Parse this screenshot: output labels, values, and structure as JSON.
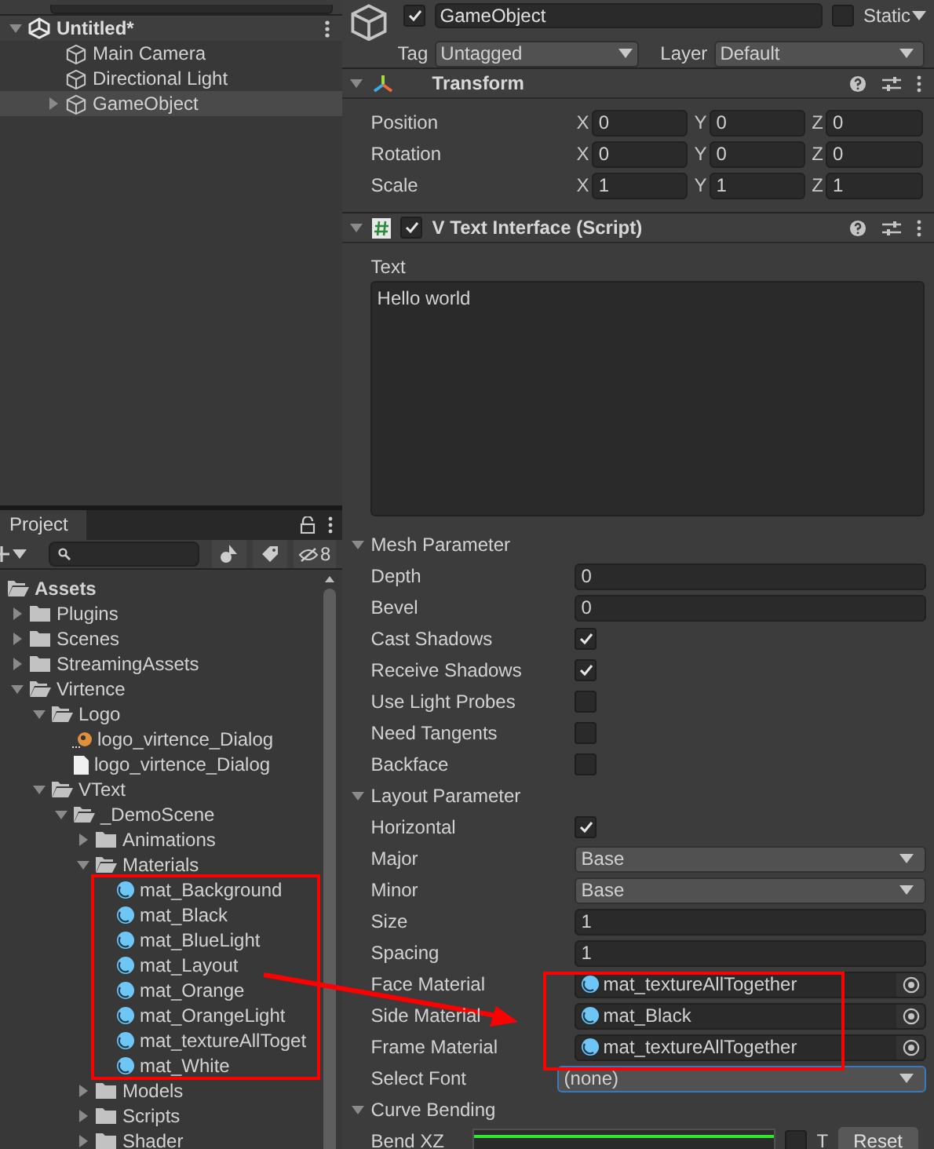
{
  "hierarchy": {
    "items": [
      {
        "label": "Untitled*",
        "kind": "scene",
        "expanded": true,
        "selected": false,
        "children": [
          {
            "label": "Main Camera",
            "kind": "object",
            "selected": false
          },
          {
            "label": "Directional Light",
            "kind": "object",
            "selected": false
          },
          {
            "label": "GameObject",
            "kind": "object",
            "expanded": false,
            "selected": true
          }
        ]
      }
    ]
  },
  "project": {
    "tab": "Project",
    "hidden_count": "8",
    "tree": [
      {
        "label": "Assets",
        "kind": "folder",
        "children": [
          {
            "label": "Plugins",
            "kind": "folder",
            "expanded": false
          },
          {
            "label": "Scenes",
            "kind": "folder",
            "expanded": false
          },
          {
            "label": "StreamingAssets",
            "kind": "folder",
            "expanded": false
          },
          {
            "label": "Virtence",
            "kind": "folder",
            "expanded": true,
            "children": [
              {
                "label": "Logo",
                "kind": "folder",
                "expanded": true,
                "children": [
                  {
                    "label": "logo_virtence_Dialog",
                    "kind": "image"
                  },
                  {
                    "label": "logo_virtence_Dialog",
                    "kind": "file"
                  }
                ]
              },
              {
                "label": "VText",
                "kind": "folder",
                "expanded": true,
                "children": [
                  {
                    "label": "_DemoScene",
                    "kind": "folder",
                    "expanded": true,
                    "children": [
                      {
                        "label": "Animations",
                        "kind": "folder",
                        "expanded": false
                      },
                      {
                        "label": "Materials",
                        "kind": "folder",
                        "expanded": true,
                        "children": [
                          {
                            "label": "mat_Background",
                            "kind": "material"
                          },
                          {
                            "label": "mat_Black",
                            "kind": "material"
                          },
                          {
                            "label": "mat_BlueLight",
                            "kind": "material"
                          },
                          {
                            "label": "mat_Layout",
                            "kind": "material"
                          },
                          {
                            "label": "mat_Orange",
                            "kind": "material"
                          },
                          {
                            "label": "mat_OrangeLight",
                            "kind": "material"
                          },
                          {
                            "label": "mat_textureAllToget",
                            "kind": "material"
                          },
                          {
                            "label": "mat_White",
                            "kind": "material"
                          }
                        ]
                      },
                      {
                        "label": "Models",
                        "kind": "folder",
                        "expanded": false
                      },
                      {
                        "label": "Scripts",
                        "kind": "folder",
                        "expanded": false
                      },
                      {
                        "label": "Shader",
                        "kind": "folder",
                        "expanded": false
                      }
                    ]
                  }
                ]
              }
            ]
          }
        ]
      }
    ]
  },
  "inspector": {
    "active": true,
    "name": "GameObject",
    "static": false,
    "static_label": "Static",
    "tag_label": "Tag",
    "tag": "Untagged",
    "layer_label": "Layer",
    "layer": "Default",
    "transform": {
      "title": "Transform",
      "expanded": true,
      "rows": [
        {
          "label": "Position",
          "axes": [
            {
              "axis": "X",
              "value": "0"
            },
            {
              "axis": "Y",
              "value": "0"
            },
            {
              "axis": "Z",
              "value": "0"
            }
          ]
        },
        {
          "label": "Rotation",
          "axes": [
            {
              "axis": "X",
              "value": "0"
            },
            {
              "axis": "Y",
              "value": "0"
            },
            {
              "axis": "Z",
              "value": "0"
            }
          ]
        },
        {
          "label": "Scale",
          "axes": [
            {
              "axis": "X",
              "value": "1"
            },
            {
              "axis": "Y",
              "value": "1"
            },
            {
              "axis": "Z",
              "value": "1"
            }
          ]
        }
      ]
    },
    "script": {
      "title": "V Text Interface (Script)",
      "enabled": true,
      "expanded": true,
      "text_label": "Text",
      "text_value": "Hello world",
      "sections": [
        {
          "title": "Mesh Parameter",
          "expanded": true,
          "fields": [
            {
              "label": "Depth",
              "kind": "number",
              "value": "0"
            },
            {
              "label": "Bevel",
              "kind": "number",
              "value": "0"
            },
            {
              "label": "Cast Shadows",
              "kind": "checkbox",
              "checked": true
            },
            {
              "label": "Receive Shadows",
              "kind": "checkbox",
              "checked": true
            },
            {
              "label": "Use Light Probes",
              "kind": "checkbox",
              "checked": false
            },
            {
              "label": "Need Tangents",
              "kind": "checkbox",
              "checked": false
            },
            {
              "label": "Backface",
              "kind": "checkbox",
              "checked": false
            }
          ]
        },
        {
          "title": "Layout Parameter",
          "expanded": true,
          "fields": [
            {
              "label": "Horizontal",
              "kind": "checkbox",
              "checked": true
            },
            {
              "label": "Major",
              "kind": "dropdown",
              "value": "Base",
              "focused": false
            },
            {
              "label": "Minor",
              "kind": "dropdown",
              "value": "Base",
              "focused": false
            },
            {
              "label": "Size",
              "kind": "number",
              "value": "1"
            },
            {
              "label": "Spacing",
              "kind": "number",
              "value": "1"
            },
            {
              "label": "Face Material",
              "kind": "object",
              "value": "mat_textureAllTogether"
            },
            {
              "label": "Side Material",
              "kind": "object",
              "value": "mat_Black"
            },
            {
              "label": "Frame Material",
              "kind": "object",
              "value": "mat_textureAllTogether"
            },
            {
              "label": "Select Font",
              "kind": "dropdown",
              "value": "(none)",
              "focused": true
            }
          ]
        },
        {
          "title": "Curve Bending",
          "expanded": true,
          "fields": [
            {
              "label": "Bend XZ",
              "kind": "curve",
              "toggle_label": "T",
              "button": "Reset"
            }
          ]
        }
      ]
    }
  }
}
